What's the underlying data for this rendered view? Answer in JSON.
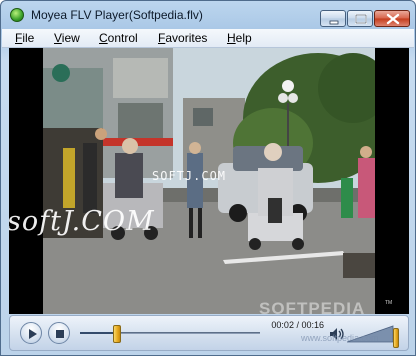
{
  "window": {
    "title": "Moyea FLV Player(Softpedia.flv)"
  },
  "menu": {
    "items": [
      "File",
      "View",
      "Control",
      "Favorites",
      "Help"
    ]
  },
  "video": {
    "watermark_large": "softJ.COM",
    "watermark_small": "SOFTJ.COM",
    "overlay_brand": "SOFTPEDIA",
    "overlay_tm": "TM",
    "overlay_url": "www.softpedia.com"
  },
  "controls": {
    "play_icon": "play-icon",
    "stop_icon": "stop-icon",
    "time_current": "00:02",
    "time_separator": " / ",
    "time_total": "00:16",
    "seek_fraction": 0.19,
    "volume_fraction": 1.0,
    "volume_icon": "speaker-icon"
  },
  "colors": {
    "title_bar": "#a9c7e6",
    "slider_thumb": "#e6a91e",
    "close_button": "#c43b1c"
  }
}
